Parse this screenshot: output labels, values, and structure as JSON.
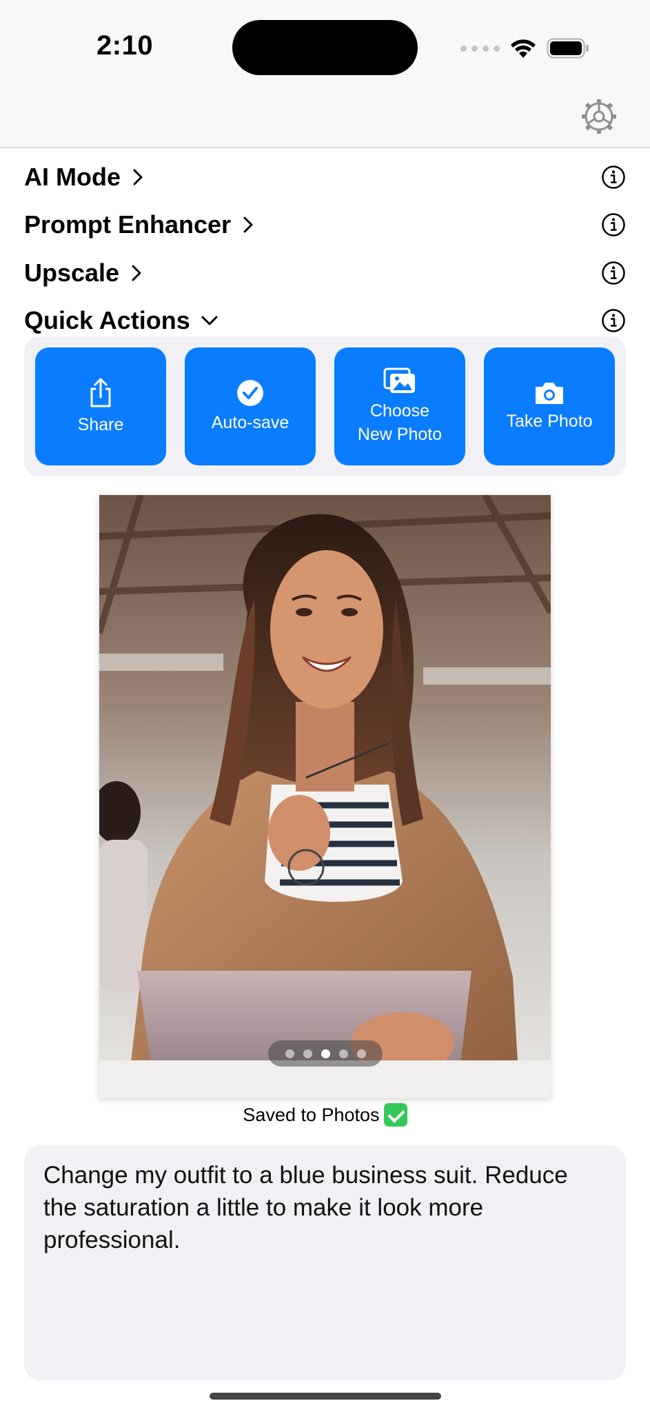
{
  "status_bar": {
    "time": "2:10"
  },
  "nav": {
    "settings_icon": "gear-icon"
  },
  "menu": {
    "ai_mode": "AI Mode",
    "prompt_enhancer": "Prompt Enhancer",
    "upscale": "Upscale",
    "quick_actions": "Quick Actions"
  },
  "quick_actions": {
    "share": "Share",
    "auto_save": "Auto-save",
    "choose_line1": "Choose",
    "choose_line2": "New Photo",
    "take_photo": "Take Photo"
  },
  "photo": {
    "pager_count": 5,
    "pager_active": 3
  },
  "saved_message": "Saved to Photos",
  "prompt": {
    "text": "Change my outfit to a blue business suit. Reduce the saturation a little to make it look more professional."
  },
  "colors": {
    "accent": "#0a7cff",
    "panel": "#f0f0f5",
    "success": "#35c759"
  }
}
